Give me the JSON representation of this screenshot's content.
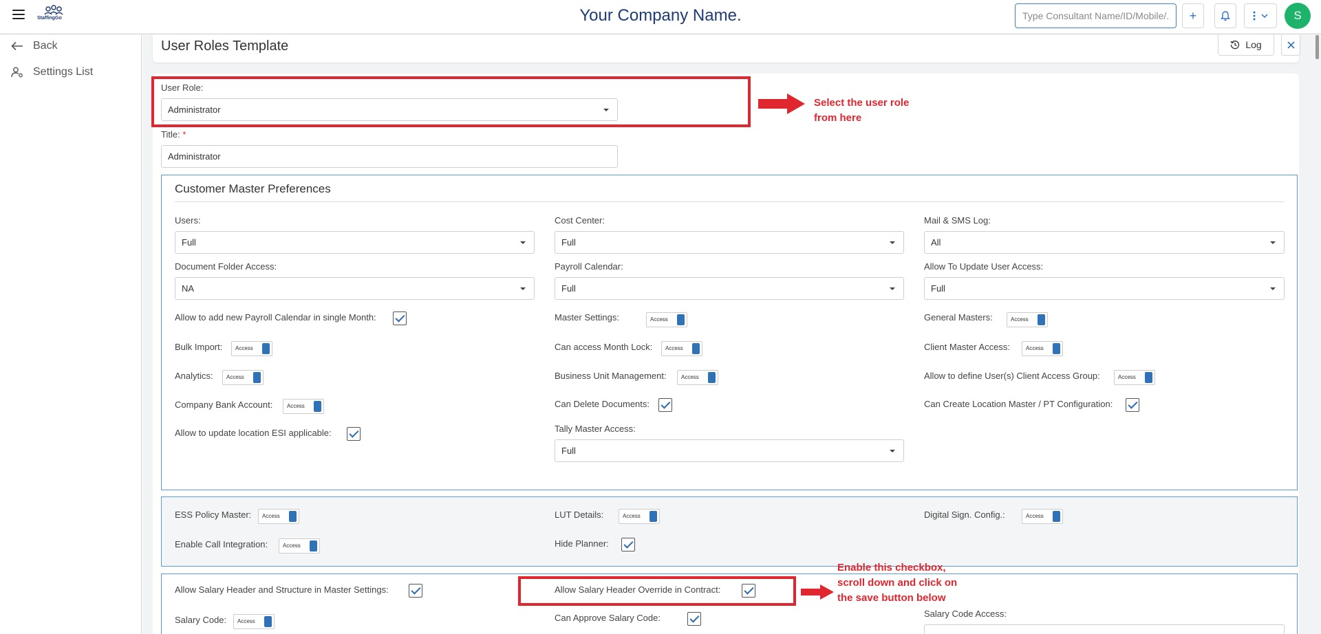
{
  "topbar": {
    "logo_text": "StaffingGo",
    "company": "Your Company Name.",
    "search_placeholder": "Type Consultant Name/ID/Mobile/...",
    "add_label": "+",
    "avatar_initial": "S"
  },
  "sidebar": {
    "back": "Back",
    "settings_list": "Settings List"
  },
  "header": {
    "title": "User Roles Template",
    "log_label": "Log"
  },
  "form": {
    "user_role_label": "User Role:",
    "user_role_value": "Administrator",
    "title_label": "Title:",
    "title_required": "*",
    "title_value": "Administrator"
  },
  "customer_master": {
    "heading": "Customer Master Preferences",
    "users_label": "Users:",
    "users_value": "Full",
    "cost_center_label": "Cost Center:",
    "cost_center_value": "Full",
    "mail_sms_label": "Mail & SMS Log:",
    "mail_sms_value": "All",
    "doc_folder_label": "Document Folder Access:",
    "doc_folder_value": "NA",
    "payroll_cal_label": "Payroll Calendar:",
    "payroll_cal_value": "Full",
    "update_user_access_label": "Allow To Update User Access:",
    "update_user_access_value": "Full",
    "add_payroll_cal_label": "Allow to add new Payroll Calendar in single Month:",
    "master_settings_label": "Master Settings:",
    "general_masters_label": "General Masters:",
    "bulk_import_label": "Bulk Import:",
    "month_lock_label": "Can access Month Lock:",
    "client_master_label": "Client Master Access:",
    "analytics_label": "Analytics:",
    "bu_mgmt_label": "Business Unit Management:",
    "client_access_group_label": "Allow to define User(s) Client Access Group:",
    "company_bank_label": "Company Bank Account:",
    "delete_docs_label": "Can Delete Documents:",
    "location_master_label": "Can Create Location Master / PT Configuration:",
    "location_esi_label": "Allow to update location ESI applicable:",
    "tally_label": "Tally Master Access:",
    "tally_value": "Full"
  },
  "ess_section": {
    "ess_policy_label": "ESS Policy Master:",
    "lut_label": "LUT Details:",
    "digital_sign_label": "Digital Sign. Config.:",
    "call_integration_label": "Enable Call Integration:",
    "hide_planner_label": "Hide Planner:"
  },
  "salary_section": {
    "header_structure_label": "Allow Salary Header and Structure in Master Settings:",
    "header_override_label": "Allow Salary Header Override in Contract:",
    "salary_code_label": "Salary Code:",
    "approve_salary_code_label": "Can Approve Salary Code:",
    "salary_code_access_label": "Salary Code Access:"
  },
  "toggle_text": "Access",
  "annotations": {
    "note1": "Select the user role\nfrom here",
    "note2": "Enable this checkbox,\nscroll down and click on\nthe save button below",
    "color": "#e0262e"
  },
  "colors": {
    "brand": "#1f3b73",
    "accent": "#2b73c8",
    "avatar": "#1db36a",
    "section_border": "#5b9bd5"
  }
}
